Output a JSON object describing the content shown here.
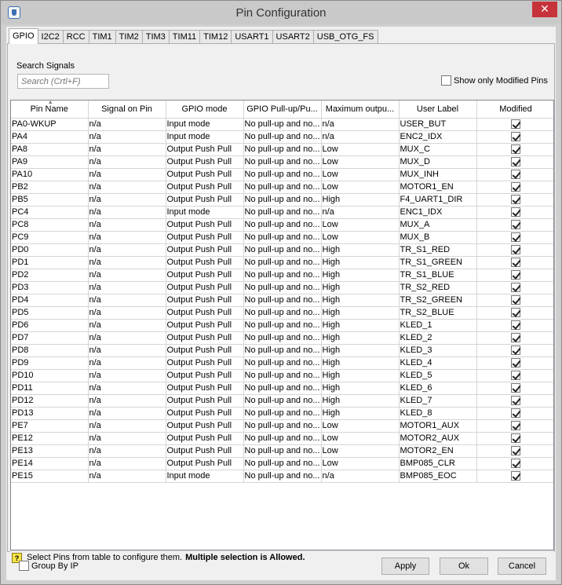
{
  "window": {
    "title": "Pin Configuration",
    "close_symbol": "✕"
  },
  "tabs": [
    {
      "label": "GPIO",
      "active": true
    },
    {
      "label": "I2C2"
    },
    {
      "label": "RCC"
    },
    {
      "label": "TIM1"
    },
    {
      "label": "TIM2"
    },
    {
      "label": "TIM3"
    },
    {
      "label": "TIM11"
    },
    {
      "label": "TIM12"
    },
    {
      "label": "USART1"
    },
    {
      "label": "USART2"
    },
    {
      "label": "USB_OTG_FS"
    }
  ],
  "search": {
    "label": "Search Signals",
    "placeholder": "Search (Crtl+F)"
  },
  "filter": {
    "show_modified_label": "Show only Modified Pins",
    "checked": false
  },
  "table": {
    "columns": [
      "Pin Name",
      "Signal on Pin",
      "GPIO mode",
      "GPIO Pull-up/Pu...",
      "Maximum outpu...",
      "User Label",
      "Modified"
    ],
    "rows": [
      [
        "PA0-WKUP",
        "n/a",
        "Input mode",
        "No pull-up and no...",
        "n/a",
        "USER_BUT"
      ],
      [
        "PA4",
        "n/a",
        "Input mode",
        "No pull-up and no...",
        "n/a",
        "ENC2_IDX"
      ],
      [
        "PA8",
        "n/a",
        "Output Push Pull",
        "No pull-up and no...",
        "Low",
        "MUX_C"
      ],
      [
        "PA9",
        "n/a",
        "Output Push Pull",
        "No pull-up and no...",
        "Low",
        "MUX_D"
      ],
      [
        "PA10",
        "n/a",
        "Output Push Pull",
        "No pull-up and no...",
        "Low",
        "MUX_INH"
      ],
      [
        "PB2",
        "n/a",
        "Output Push Pull",
        "No pull-up and no...",
        "Low",
        "MOTOR1_EN"
      ],
      [
        "PB5",
        "n/a",
        "Output Push Pull",
        "No pull-up and no...",
        "High",
        "F4_UART1_DIR"
      ],
      [
        "PC4",
        "n/a",
        "Input mode",
        "No pull-up and no...",
        "n/a",
        "ENC1_IDX"
      ],
      [
        "PC8",
        "n/a",
        "Output Push Pull",
        "No pull-up and no...",
        "Low",
        "MUX_A"
      ],
      [
        "PC9",
        "n/a",
        "Output Push Pull",
        "No pull-up and no...",
        "Low",
        "MUX_B"
      ],
      [
        "PD0",
        "n/a",
        "Output Push Pull",
        "No pull-up and no...",
        "High",
        "TR_S1_RED"
      ],
      [
        "PD1",
        "n/a",
        "Output Push Pull",
        "No pull-up and no...",
        "High",
        "TR_S1_GREEN"
      ],
      [
        "PD2",
        "n/a",
        "Output Push Pull",
        "No pull-up and no...",
        "High",
        "TR_S1_BLUE"
      ],
      [
        "PD3",
        "n/a",
        "Output Push Pull",
        "No pull-up and no...",
        "High",
        "TR_S2_RED"
      ],
      [
        "PD4",
        "n/a",
        "Output Push Pull",
        "No pull-up and no...",
        "High",
        "TR_S2_GREEN"
      ],
      [
        "PD5",
        "n/a",
        "Output Push Pull",
        "No pull-up and no...",
        "High",
        "TR_S2_BLUE"
      ],
      [
        "PD6",
        "n/a",
        "Output Push Pull",
        "No pull-up and no...",
        "High",
        "KLED_1"
      ],
      [
        "PD7",
        "n/a",
        "Output Push Pull",
        "No pull-up and no...",
        "High",
        "KLED_2"
      ],
      [
        "PD8",
        "n/a",
        "Output Push Pull",
        "No pull-up and no...",
        "High",
        "KLED_3"
      ],
      [
        "PD9",
        "n/a",
        "Output Push Pull",
        "No pull-up and no...",
        "High",
        "KLED_4"
      ],
      [
        "PD10",
        "n/a",
        "Output Push Pull",
        "No pull-up and no...",
        "High",
        "KLED_5"
      ],
      [
        "PD11",
        "n/a",
        "Output Push Pull",
        "No pull-up and no...",
        "High",
        "KLED_6"
      ],
      [
        "PD12",
        "n/a",
        "Output Push Pull",
        "No pull-up and no...",
        "High",
        "KLED_7"
      ],
      [
        "PD13",
        "n/a",
        "Output Push Pull",
        "No pull-up and no...",
        "High",
        "KLED_8"
      ],
      [
        "PE7",
        "n/a",
        "Output Push Pull",
        "No pull-up and no...",
        "Low",
        "MOTOR1_AUX"
      ],
      [
        "PE12",
        "n/a",
        "Output Push Pull",
        "No pull-up and no...",
        "Low",
        "MOTOR2_AUX"
      ],
      [
        "PE13",
        "n/a",
        "Output Push Pull",
        "No pull-up and no...",
        "Low",
        "MOTOR2_EN"
      ],
      [
        "PE14",
        "n/a",
        "Output Push Pull",
        "No pull-up and no...",
        "Low",
        "BMP085_CLR"
      ],
      [
        "PE15",
        "n/a",
        "Input mode",
        "No pull-up and no...",
        "n/a",
        "BMP085_EOC"
      ]
    ]
  },
  "hint": {
    "icon_text": "?",
    "text": "Select Pins from table to configure them.",
    "bold_text": "Multiple selection is Allowed."
  },
  "footer": {
    "group_by_label": "Group By IP",
    "apply_label": "Apply",
    "ok_label": "Ok",
    "cancel_label": "Cancel"
  }
}
